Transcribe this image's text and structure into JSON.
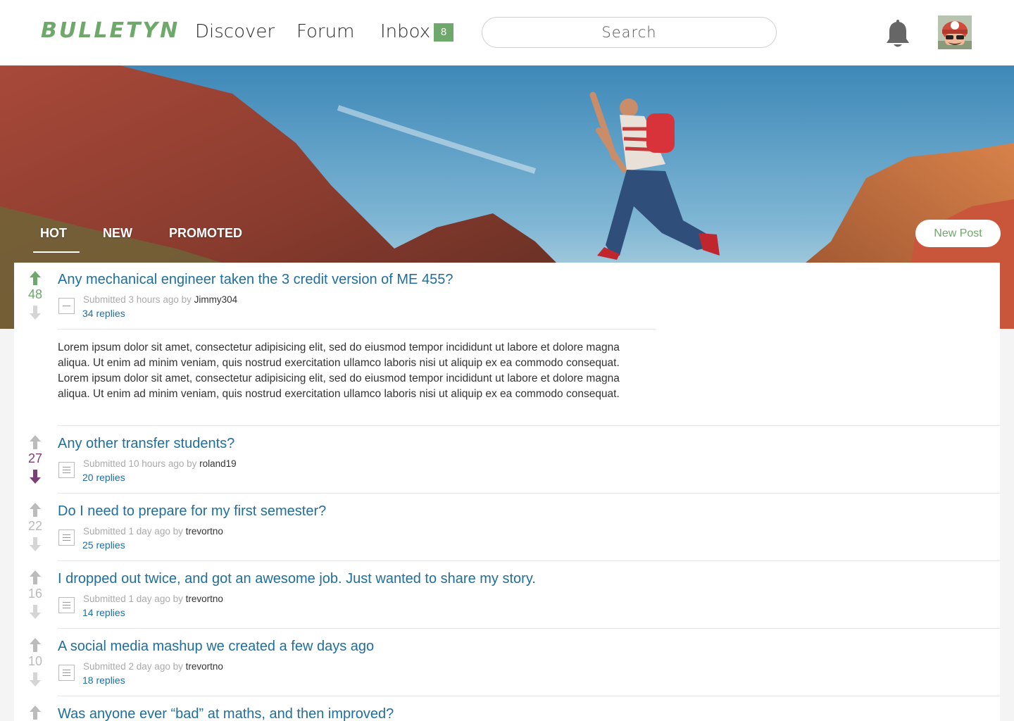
{
  "header": {
    "logo": "BULLETYN",
    "nav": {
      "discover": "Discover",
      "forum": "Forum",
      "inbox": "Inbox"
    },
    "inbox_count": "8",
    "search_placeholder": "Search",
    "bell_icon": "bell-icon",
    "avatar_icon": "user-avatar"
  },
  "hero": {
    "tabs": [
      "HOT",
      "NEW",
      "PROMOTED"
    ],
    "active_tab": "HOT",
    "new_post_label": "New Post"
  },
  "colors": {
    "brand_green": "#6ea86a",
    "link_blue": "#1f6e9c",
    "downvote_purple": "#7a3f78",
    "upvote_green": "#6ea86a",
    "neutral_gray": "#bbbbbb"
  },
  "posts": [
    {
      "votes": "48",
      "vote_state": "up",
      "title": "Any mechanical engineer taken the 3 credit version of ME 455?",
      "submitted": "Submitted 3 hours ago by ",
      "author": "Jimmy304",
      "replies": "34 replies",
      "expanded": true,
      "body": "Lorem ipsum dolor sit amet, consectetur adipisicing elit, sed do eiusmod tempor incididunt ut labore et dolore magna aliqua. Ut enim ad minim veniam, quis nostrud exercitation ullamco laboris nisi ut aliquip ex ea commodo consequat. Lorem ipsum dolor sit amet, consectetur adipisicing elit, sed do eiusmod tempor incididunt ut labore et dolore magna aliqua. Ut enim ad minim veniam, quis nostrud exercitation ullamco laboris nisi ut aliquip ex ea commodo consequat."
    },
    {
      "votes": "27",
      "vote_state": "down",
      "title": "Any other transfer students?",
      "submitted": "Submitted 10 hours ago by ",
      "author": "roland19",
      "replies": "20 replies"
    },
    {
      "votes": "22",
      "vote_state": "none",
      "title": "Do I need to prepare for my first semester?",
      "submitted": "Submitted 1 day ago by ",
      "author": "trevortno",
      "replies": "25 replies"
    },
    {
      "votes": "16",
      "vote_state": "none",
      "title": "I dropped out twice, and got an awesome job. Just wanted to share my story.",
      "submitted": "Submitted 1 day ago by ",
      "author": "trevortno",
      "replies": "14 replies"
    },
    {
      "votes": "10",
      "vote_state": "none",
      "title": "A social media mashup we created a few days ago",
      "submitted": "Submitted 2 day ago by ",
      "author": "trevortno",
      "replies": "18 replies"
    },
    {
      "votes": "",
      "vote_state": "none",
      "title": "Was anyone ever “bad” at maths, and then improved?",
      "submitted": "",
      "author": "",
      "replies": ""
    }
  ]
}
